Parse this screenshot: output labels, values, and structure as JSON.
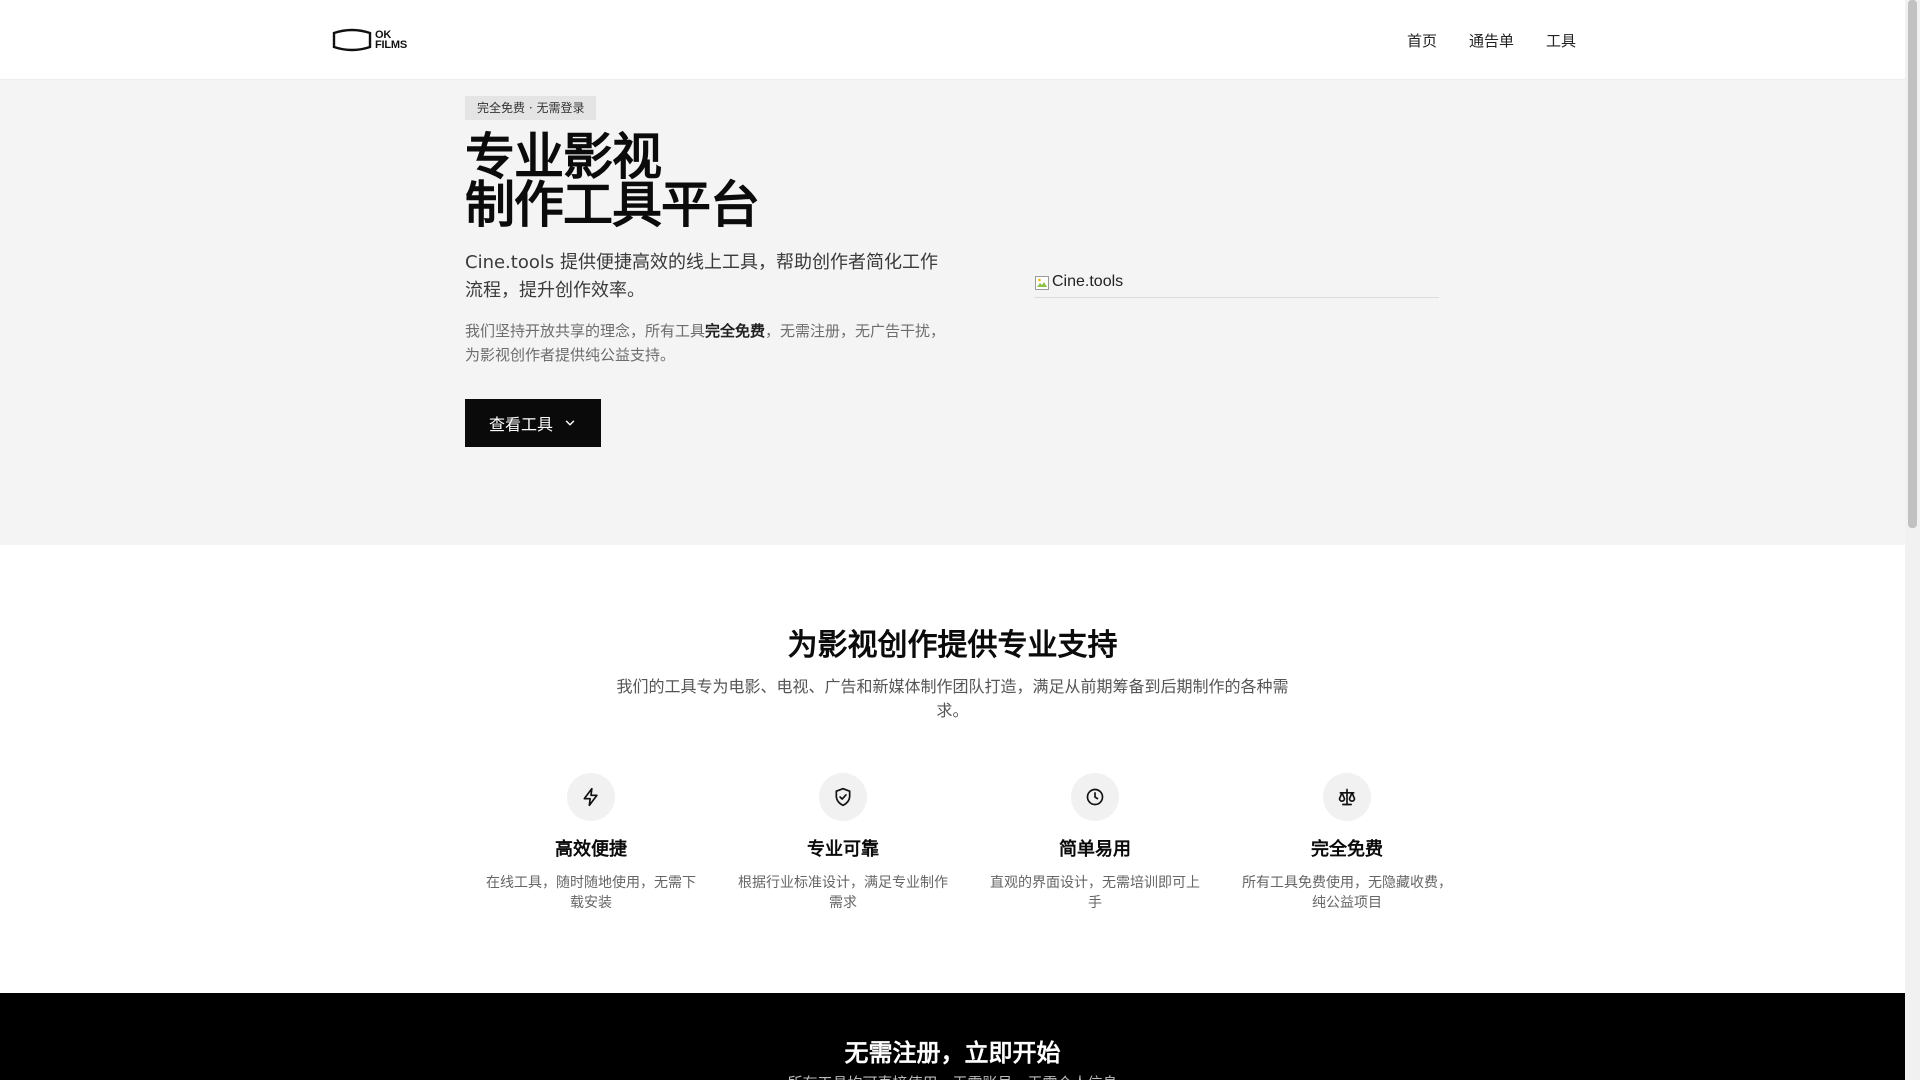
{
  "header": {
    "logo": {
      "line1": "OK",
      "line2": "FILMS"
    },
    "nav": [
      {
        "label": "首页"
      },
      {
        "label": "通告单"
      },
      {
        "label": "工具"
      }
    ]
  },
  "hero": {
    "badge": "完全免费 · 无需登录",
    "title_line1": "专业影视",
    "title_line2": "制作工具平台",
    "lead": "Cine.tools 提供便捷高效的线上工具，帮助创作者简化工作流程，提升创作效率。",
    "desc_before": "我们坚持开放共享的理念，所有工具",
    "desc_strong": "完全免费",
    "desc_after": "，无需注册，无广告干扰，为影视创作者提供纯公益支持。",
    "cta_label": "查看工具",
    "image_alt": "Cine.tools"
  },
  "features": {
    "title": "为影视创作提供专业支持",
    "subtitle": "我们的工具专为电影、电视、广告和新媒体制作团队打造，满足从前期筹备到后期制作的各种需求。",
    "items": [
      {
        "icon": "lightning-icon",
        "title": "高效便捷",
        "desc": "在线工具，随时随地使用，无需下载安装"
      },
      {
        "icon": "shield-check-icon",
        "title": "专业可靠",
        "desc": "根据行业标准设计，满足专业制作需求"
      },
      {
        "icon": "clock-icon",
        "title": "简单易用",
        "desc": "直观的界面设计，无需培训即可上手"
      },
      {
        "icon": "scale-icon",
        "title": "完全免费",
        "desc": "所有工具免费使用，无隐藏收费，纯公益项目"
      }
    ]
  },
  "bottom": {
    "title": "无需注册，立即开始",
    "subtitle": "所有工具均可直接使用，无需账号，无需个人信息"
  },
  "colors": {
    "hero_bg": "#f4f4f4",
    "primary": "#0a0a0a",
    "bottom_bg": "#000000"
  }
}
